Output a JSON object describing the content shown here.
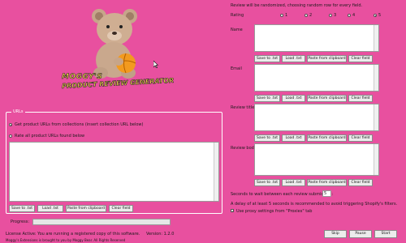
{
  "logo": {
    "title_line1": "MOGGY'S",
    "title_line2": "PRODUCT REVIEW GENERATOR"
  },
  "url_box": {
    "group_title": "URLs",
    "option_collection": "Get product URLs from collections (insert collection URL below)",
    "option_all": "Rate all product URLs found below",
    "buttons": [
      "Save to .txt",
      "Load .txt",
      "Paste from clipboard",
      "Clear field"
    ]
  },
  "progress": {
    "label": "Progress:"
  },
  "right": {
    "notice": "Review will be randomized, choosing random row for every field.",
    "rating": {
      "label": "Rating",
      "options": [
        "1",
        "2",
        "3",
        "4",
        "5"
      ],
      "selected": "5"
    },
    "sections": [
      {
        "label": "Name"
      },
      {
        "label": "Email"
      },
      {
        "label": "Review title"
      },
      {
        "label": "Review body"
      }
    ],
    "field_buttons": [
      "Save to .txt",
      "Load .txt",
      "Paste from clipboard",
      "Clear field"
    ],
    "wait_label": "Seconds to wait between each review submission:",
    "wait_value": "5",
    "delay_note": "A delay of at least 5 seconds is recommended to avoid triggering Shopify's filters.",
    "proxy_label": "Use proxy settings from \"Proxies\" tab",
    "proxy_checked": true
  },
  "footer": {
    "license": "License Active: You are running a registered copy of this software.",
    "version": "Version: 1.2.0",
    "credit": "Moggy's Extensions is brought to you by Moggy Bear. All Rights Reserved",
    "buttons": {
      "skip": "Skip",
      "pause": "Pause",
      "start": "Start"
    }
  }
}
